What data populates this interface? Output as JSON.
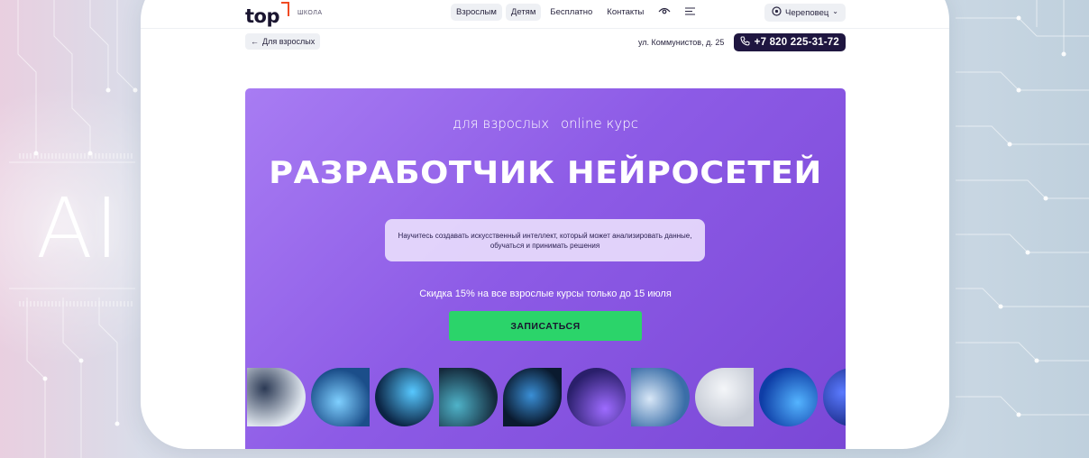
{
  "background": {
    "ai_label": "AI",
    "colors": {
      "grad_left": "#e9cfe0",
      "grad_right": "#bfd0dd",
      "circuit": "#ffffff"
    }
  },
  "header": {
    "logo_word": "top",
    "logo_sub": "ШКОЛА",
    "nav": [
      {
        "label": "Взрослым",
        "active": true
      },
      {
        "label": "Детям",
        "active": true
      },
      {
        "label": "Бесплатно",
        "active": false
      },
      {
        "label": "Контакты",
        "active": false
      }
    ],
    "accessibility_icon": "eye-icon",
    "menu_icon": "hamburger-menu-icon",
    "city_icon": "location-pin-icon",
    "city": "Череповец",
    "city_chevron": "⌄"
  },
  "subheader": {
    "back_arrow": "←",
    "back_label": "Для взрослых",
    "address": "ул. Коммунистов, д. 25",
    "phone_icon": "phone-icon",
    "phone": "+7 820 225-31-72"
  },
  "hero": {
    "tag1": "для взрослых",
    "tag2": "online курс",
    "title": "РАЗРАБОТЧИК НЕЙРОСЕТЕЙ",
    "description": "Научитесь создавать искусственный интеллект, который может анализировать данные, обучаться и принимать решения",
    "promo": "Скидка 15% на все взрослые курсы только до 15 июля",
    "cta_label": "ЗАПИСАТЬСЯ",
    "colors": {
      "hero_start": "#a87cf3",
      "hero_end": "#7a47d6",
      "cta": "#2bd46a",
      "phone_bg": "#1f1640",
      "logo_accent": "#f04a22"
    },
    "gallery": [
      {
        "name": "developer-monitors-photo",
        "shape": "r-right",
        "c1": "#dfe6ee",
        "c2": "#2c3a55"
      },
      {
        "name": "dashboard-laptop-photo",
        "shape": "r-left",
        "c1": "#1b4e8a",
        "c2": "#7fd0ff"
      },
      {
        "name": "neural-grid-photo",
        "shape": "circle",
        "c1": "#0b2545",
        "c2": "#57c8ff"
      },
      {
        "name": "coder-hoodie-photo",
        "shape": "r-right",
        "c1": "#142a3c",
        "c2": "#4fb3c9"
      },
      {
        "name": "brain-network-photo",
        "shape": "r-tl",
        "c1": "#0a1a2f",
        "c2": "#3a8fd6"
      },
      {
        "name": "robot-hand-photo",
        "shape": "circle",
        "c1": "#2a1f6b",
        "c2": "#9d6bff"
      },
      {
        "name": "engineer-glasses-photo",
        "shape": "r-right",
        "c1": "#3a6ea8",
        "c2": "#d8e7f7"
      },
      {
        "name": "robot-arm-photo",
        "shape": "r-left",
        "c1": "#c7ccd6",
        "c2": "#f4f6f9"
      },
      {
        "name": "blue-wave-photo",
        "shape": "circle",
        "c1": "#0e3da6",
        "c2": "#54b4ff"
      },
      {
        "name": "cyber-lines-photo",
        "shape": "r-left",
        "c1": "#1a2b8a",
        "c2": "#5b7bff"
      }
    ]
  }
}
